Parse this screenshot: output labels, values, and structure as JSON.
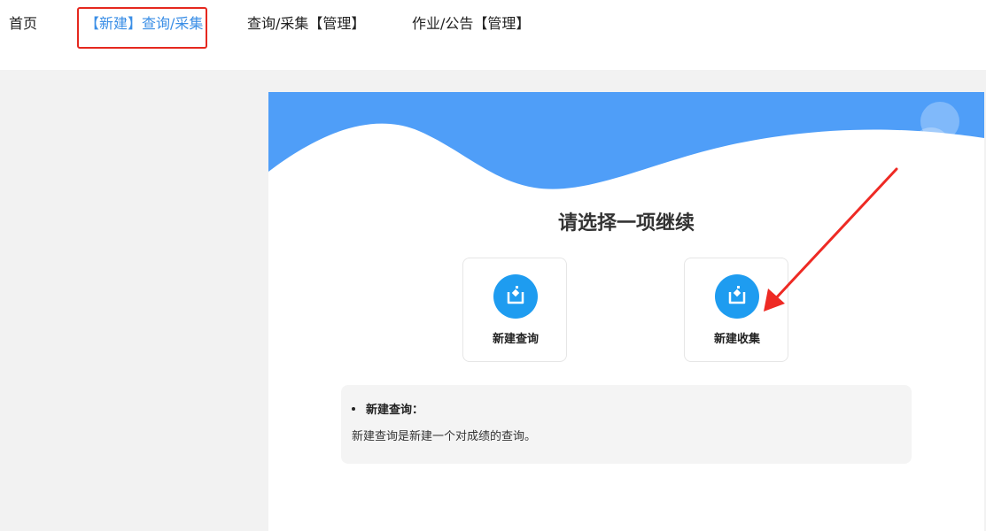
{
  "nav": {
    "items": [
      {
        "label": "首页"
      },
      {
        "label": "【新建】查询/采集"
      },
      {
        "label": "查询/采集【管理】"
      },
      {
        "label": "作业/公告【管理】"
      }
    ]
  },
  "main": {
    "prompt": "请选择一项继续",
    "options": [
      {
        "label": "新建查询",
        "icon": "upload-box-icon"
      },
      {
        "label": "新建收集",
        "icon": "upload-box-icon"
      }
    ],
    "info": {
      "title": "新建查询：",
      "description": "新建查询是新建一个对成绩的查询。"
    }
  },
  "colors": {
    "accent": "#3a8ee6",
    "banner": "#4f9ef8",
    "icon_bg": "#1e9cf0",
    "highlight": "#e5281f"
  }
}
